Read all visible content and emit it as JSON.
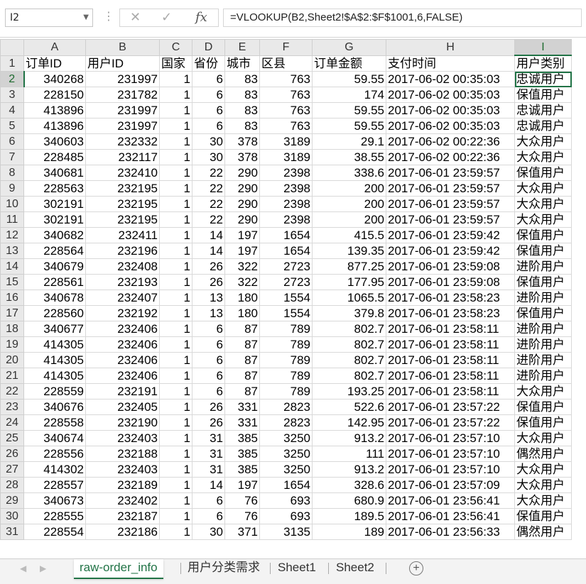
{
  "formula_bar": {
    "name_box": "I2",
    "cancel_icon": "✕",
    "enter_icon": "✓",
    "fx_label": "fx",
    "formula": "=VLOOKUP(B2,Sheet2!$A$2:$F$1001,6,FALSE)"
  },
  "columns": [
    "A",
    "B",
    "C",
    "D",
    "E",
    "F",
    "G",
    "H",
    "I"
  ],
  "selected_column": "I",
  "selected_row": 2,
  "headers": [
    "订单ID",
    "用户ID",
    "国家",
    "省份",
    "城市",
    "区县",
    "订单金额",
    "支付时间",
    "用户类别"
  ],
  "rows": [
    [
      "340268",
      "231997",
      "1",
      "6",
      "83",
      "763",
      "59.55",
      "2017-06-02 00:35:03",
      "忠诚用户"
    ],
    [
      "228150",
      "231782",
      "1",
      "6",
      "83",
      "763",
      "174",
      "2017-06-02 00:35:03",
      "保值用户"
    ],
    [
      "413896",
      "231997",
      "1",
      "6",
      "83",
      "763",
      "59.55",
      "2017-06-02 00:35:03",
      "忠诚用户"
    ],
    [
      "413896",
      "231997",
      "1",
      "6",
      "83",
      "763",
      "59.55",
      "2017-06-02 00:35:03",
      "忠诚用户"
    ],
    [
      "340603",
      "232332",
      "1",
      "30",
      "378",
      "3189",
      "29.1",
      "2017-06-02 00:22:36",
      "大众用户"
    ],
    [
      "228485",
      "232117",
      "1",
      "30",
      "378",
      "3189",
      "38.55",
      "2017-06-02 00:22:36",
      "大众用户"
    ],
    [
      "340681",
      "232410",
      "1",
      "22",
      "290",
      "2398",
      "338.6",
      "2017-06-01 23:59:57",
      "保值用户"
    ],
    [
      "228563",
      "232195",
      "1",
      "22",
      "290",
      "2398",
      "200",
      "2017-06-01 23:59:57",
      "大众用户"
    ],
    [
      "302191",
      "232195",
      "1",
      "22",
      "290",
      "2398",
      "200",
      "2017-06-01 23:59:57",
      "大众用户"
    ],
    [
      "302191",
      "232195",
      "1",
      "22",
      "290",
      "2398",
      "200",
      "2017-06-01 23:59:57",
      "大众用户"
    ],
    [
      "340682",
      "232411",
      "1",
      "14",
      "197",
      "1654",
      "415.5",
      "2017-06-01 23:59:42",
      "保值用户"
    ],
    [
      "228564",
      "232196",
      "1",
      "14",
      "197",
      "1654",
      "139.35",
      "2017-06-01 23:59:42",
      "保值用户"
    ],
    [
      "340679",
      "232408",
      "1",
      "26",
      "322",
      "2723",
      "877.25",
      "2017-06-01 23:59:08",
      "进阶用户"
    ],
    [
      "228561",
      "232193",
      "1",
      "26",
      "322",
      "2723",
      "177.95",
      "2017-06-01 23:59:08",
      "保值用户"
    ],
    [
      "340678",
      "232407",
      "1",
      "13",
      "180",
      "1554",
      "1065.5",
      "2017-06-01 23:58:23",
      "进阶用户"
    ],
    [
      "228560",
      "232192",
      "1",
      "13",
      "180",
      "1554",
      "379.8",
      "2017-06-01 23:58:23",
      "保值用户"
    ],
    [
      "340677",
      "232406",
      "1",
      "6",
      "87",
      "789",
      "802.7",
      "2017-06-01 23:58:11",
      "进阶用户"
    ],
    [
      "414305",
      "232406",
      "1",
      "6",
      "87",
      "789",
      "802.7",
      "2017-06-01 23:58:11",
      "进阶用户"
    ],
    [
      "414305",
      "232406",
      "1",
      "6",
      "87",
      "789",
      "802.7",
      "2017-06-01 23:58:11",
      "进阶用户"
    ],
    [
      "414305",
      "232406",
      "1",
      "6",
      "87",
      "789",
      "802.7",
      "2017-06-01 23:58:11",
      "进阶用户"
    ],
    [
      "228559",
      "232191",
      "1",
      "6",
      "87",
      "789",
      "193.25",
      "2017-06-01 23:58:11",
      "大众用户"
    ],
    [
      "340676",
      "232405",
      "1",
      "26",
      "331",
      "2823",
      "522.6",
      "2017-06-01 23:57:22",
      "保值用户"
    ],
    [
      "228558",
      "232190",
      "1",
      "26",
      "331",
      "2823",
      "142.95",
      "2017-06-01 23:57:22",
      "保值用户"
    ],
    [
      "340674",
      "232403",
      "1",
      "31",
      "385",
      "3250",
      "913.2",
      "2017-06-01 23:57:10",
      "大众用户"
    ],
    [
      "228556",
      "232188",
      "1",
      "31",
      "385",
      "3250",
      "111",
      "2017-06-01 23:57:10",
      "偶然用户"
    ],
    [
      "414302",
      "232403",
      "1",
      "31",
      "385",
      "3250",
      "913.2",
      "2017-06-01 23:57:10",
      "大众用户"
    ],
    [
      "228557",
      "232189",
      "1",
      "14",
      "197",
      "1654",
      "328.6",
      "2017-06-01 23:57:09",
      "大众用户"
    ],
    [
      "340673",
      "232402",
      "1",
      "6",
      "76",
      "693",
      "680.9",
      "2017-06-01 23:56:41",
      "大众用户"
    ],
    [
      "228555",
      "232187",
      "1",
      "6",
      "76",
      "693",
      "189.5",
      "2017-06-01 23:56:41",
      "保值用户"
    ],
    [
      "228554",
      "232186",
      "1",
      "30",
      "371",
      "3135",
      "189",
      "2017-06-01 23:56:33",
      "偶然用户"
    ]
  ],
  "sheet_tabs": [
    "raw-order_info",
    "用户分类需求",
    "Sheet1",
    "Sheet2"
  ],
  "active_tab": 0,
  "add_sheet_icon": "+"
}
